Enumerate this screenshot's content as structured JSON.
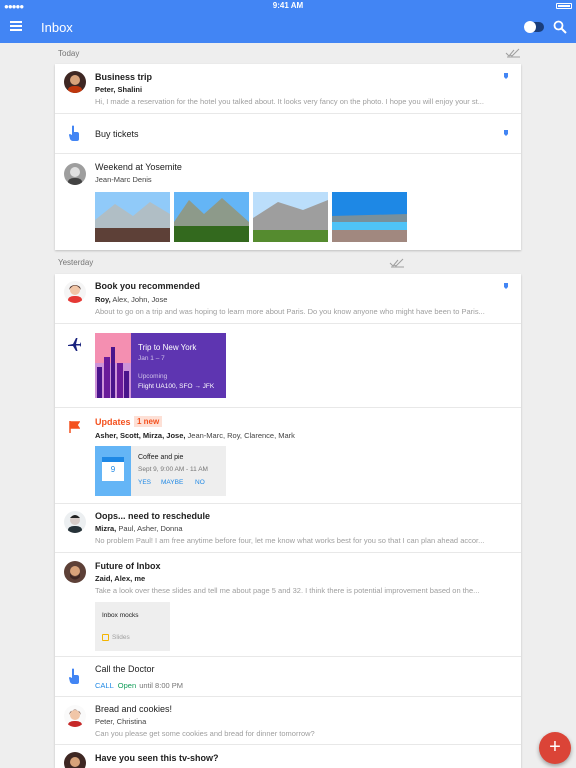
{
  "status_bar": {
    "carrier_dots": "●●●●●",
    "time": "9:41 AM"
  },
  "app_bar": {
    "title": "Inbox"
  },
  "colors": {
    "primary": "#4285f4",
    "accent_red": "#db4437",
    "updates_orange": "#f4511e",
    "link_blue": "#1e88e5",
    "open_green": "#0f9d58",
    "trip_purple": "#5e35b1"
  },
  "sections": {
    "today": "Today",
    "yesterday": "Yesterday"
  },
  "today": {
    "business_trip": {
      "subject": "Business trip",
      "senders": "Peter, Shalini",
      "snippet": "Hi, I made a reservation for the hotel you talked about. It looks very fancy on the photo. I hope you will enjoy your st..."
    },
    "buy_tickets": {
      "subject": "Buy tickets"
    },
    "yosemite": {
      "subject": "Weekend at Yosemite",
      "senders": "Jean-Marc Denis"
    }
  },
  "yesterday": {
    "book": {
      "subject": "Book you recommended",
      "senders_bold": "Roy,",
      "senders_rest": " Alex, John, Jose",
      "snippet": "About to go on a trip and was hoping to learn more about Paris. Do you know anyone who might have been to Paris..."
    },
    "trip": {
      "title": "Trip to New York",
      "dates": "Jan 1 – 7",
      "status": "Upcoming",
      "flight": "Flight UA100,  SFO → JFK"
    },
    "updates": {
      "title": "Updates",
      "badge": "1 new",
      "senders_bold": "Asher, Scott, Mirza, Jose,",
      "senders_rest": " Jean-Marc, Roy, Clarence, Mark",
      "event": {
        "day": "9",
        "name": "Coffee and pie",
        "when": "Sept 9, 9:00 AM - 11 AM",
        "yes": "YES",
        "maybe": "MAYBE",
        "no": "NO"
      }
    },
    "reschedule": {
      "subject": "Oops... need to reschedule",
      "senders_bold": "Mizra,",
      "senders_rest": " Paul, Asher, Donna",
      "snippet": "No problem Paul! I am free anytime before four, let me know what works best for you so that I can plan ahead accor..."
    },
    "future": {
      "subject": "Future of Inbox",
      "senders": "Zaid, Alex, me",
      "snippet": "Take a look over these slides and tell me about page 5 and 32. I think there is potential improvement based on the...",
      "attachment": {
        "name": "Inbox mocks",
        "type": "Slides"
      }
    },
    "doctor": {
      "subject": "Call the Doctor",
      "call": "CALL",
      "open": "Open",
      "until": "until 8:00 PM"
    },
    "bread": {
      "subject": "Bread and cookies!",
      "senders": "Peter, Christina",
      "snippet": "Can you please get some cookies and bread for dinner tomorrow?"
    },
    "tvshow": {
      "subject": "Have you seen this tv-show?"
    }
  },
  "fab": {
    "label": "+"
  }
}
